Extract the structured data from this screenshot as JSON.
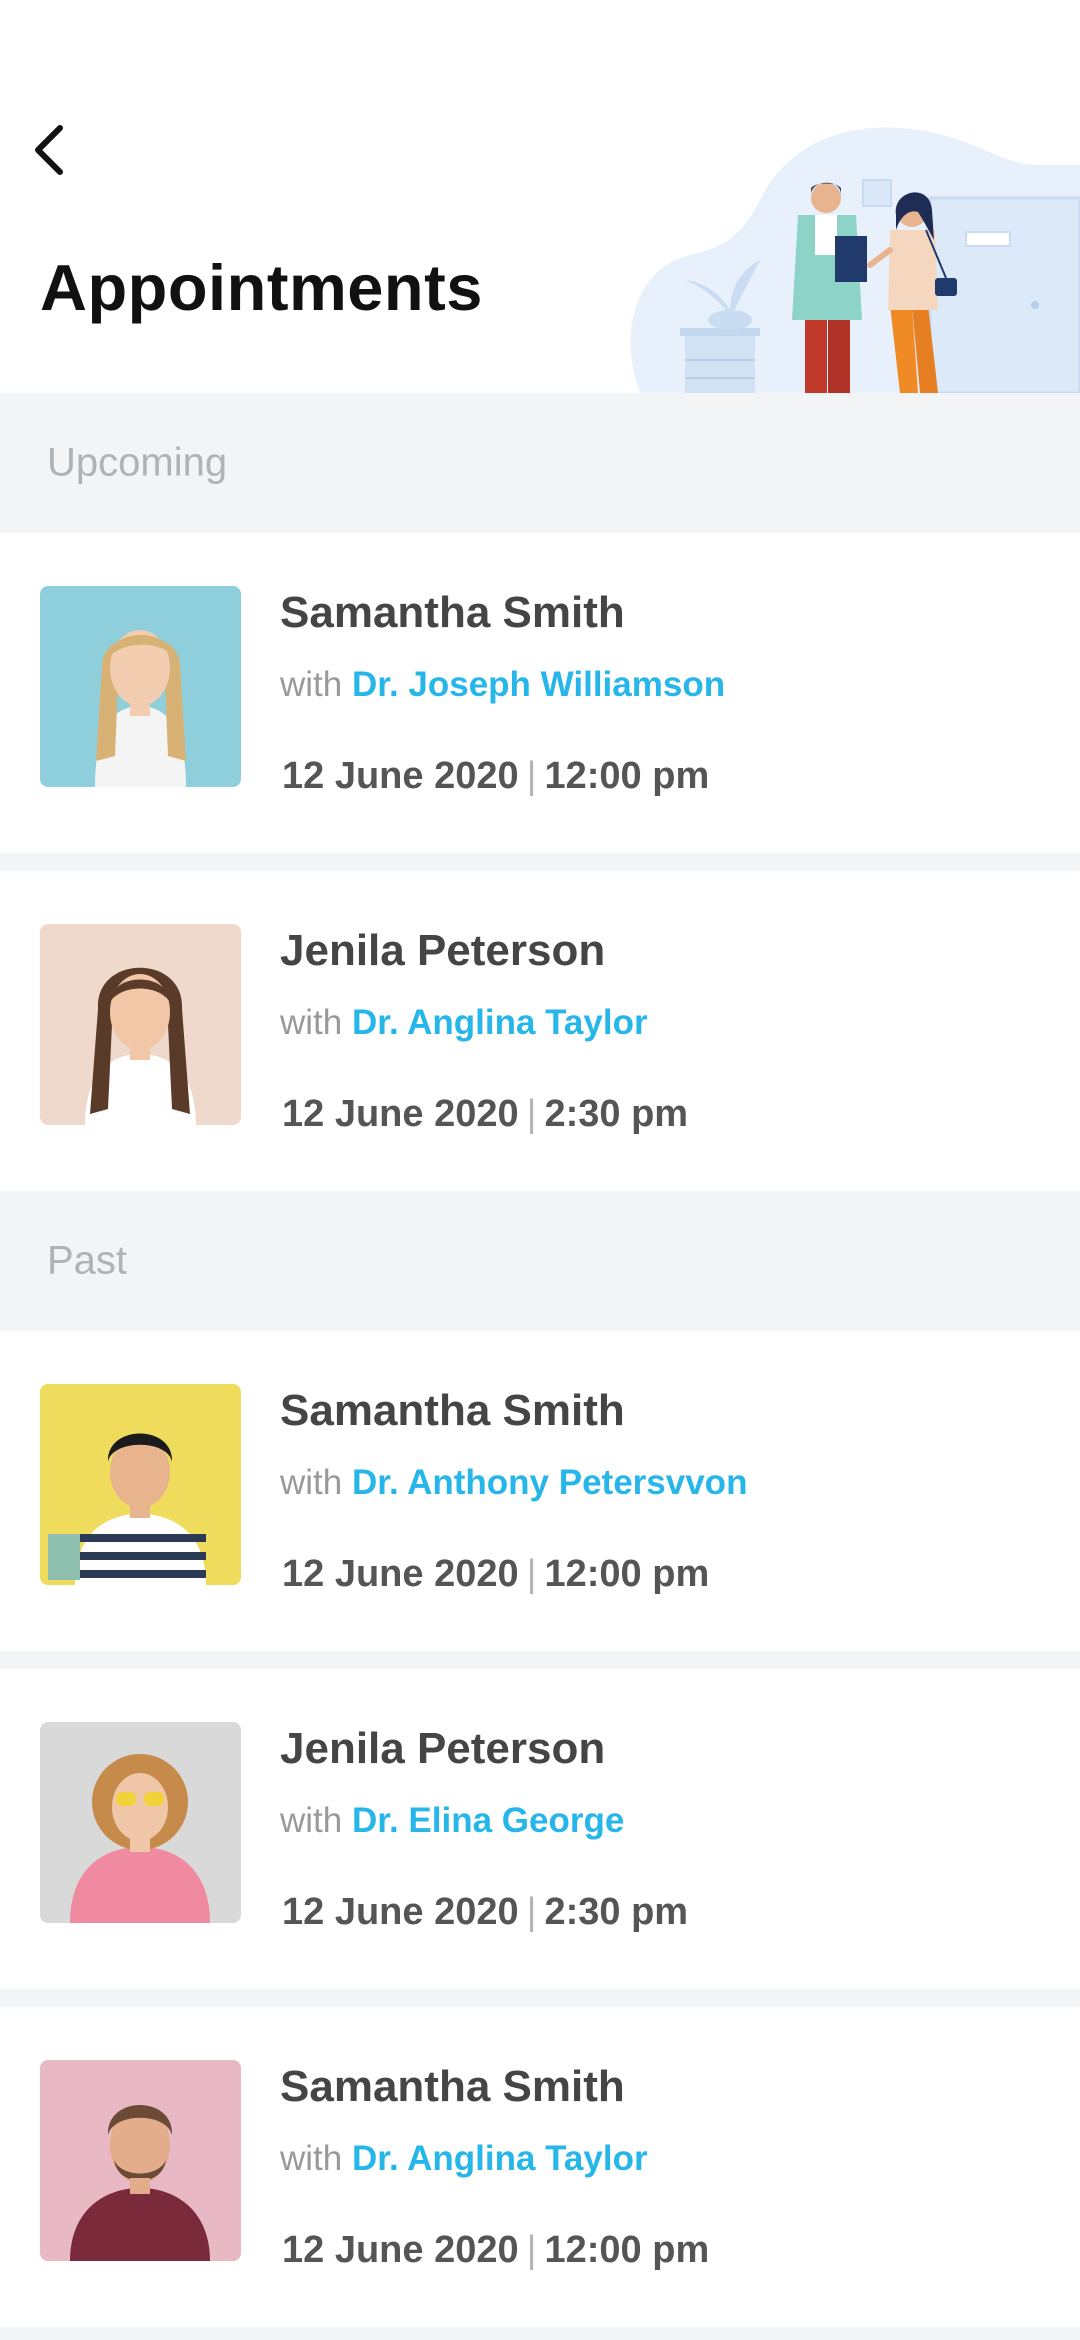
{
  "header": {
    "title": "Appointments",
    "back_icon": "chevron-left-icon"
  },
  "sections": {
    "upcoming": "Upcoming",
    "past": "Past"
  },
  "with_prefix": "with",
  "upcoming": [
    {
      "patient": "Samantha Smith",
      "doctor": "Dr. Joseph Williamson",
      "date": "12 June 2020",
      "time": "12:00 pm"
    },
    {
      "patient": "Jenila Peterson",
      "doctor": "Dr. Anglina Taylor",
      "date": "12 June 2020",
      "time": "2:30 pm"
    }
  ],
  "past": [
    {
      "patient": "Samantha Smith",
      "doctor": "Dr. Anthony Petersvvon",
      "date": "12 June 2020",
      "time": "12:00 pm"
    },
    {
      "patient": "Jenila Peterson",
      "doctor": "Dr. Elina George",
      "date": "12 June 2020",
      "time": "2:30 pm"
    },
    {
      "patient": "Samantha Smith",
      "doctor": "Dr. Anglina Taylor",
      "date": "12 June 2020",
      "time": "12:00 pm"
    }
  ],
  "colors": {
    "accent": "#27b6ea",
    "section_bg": "#f2f4f6",
    "title": "#111111",
    "name": "#454545",
    "muted": "#999999"
  }
}
